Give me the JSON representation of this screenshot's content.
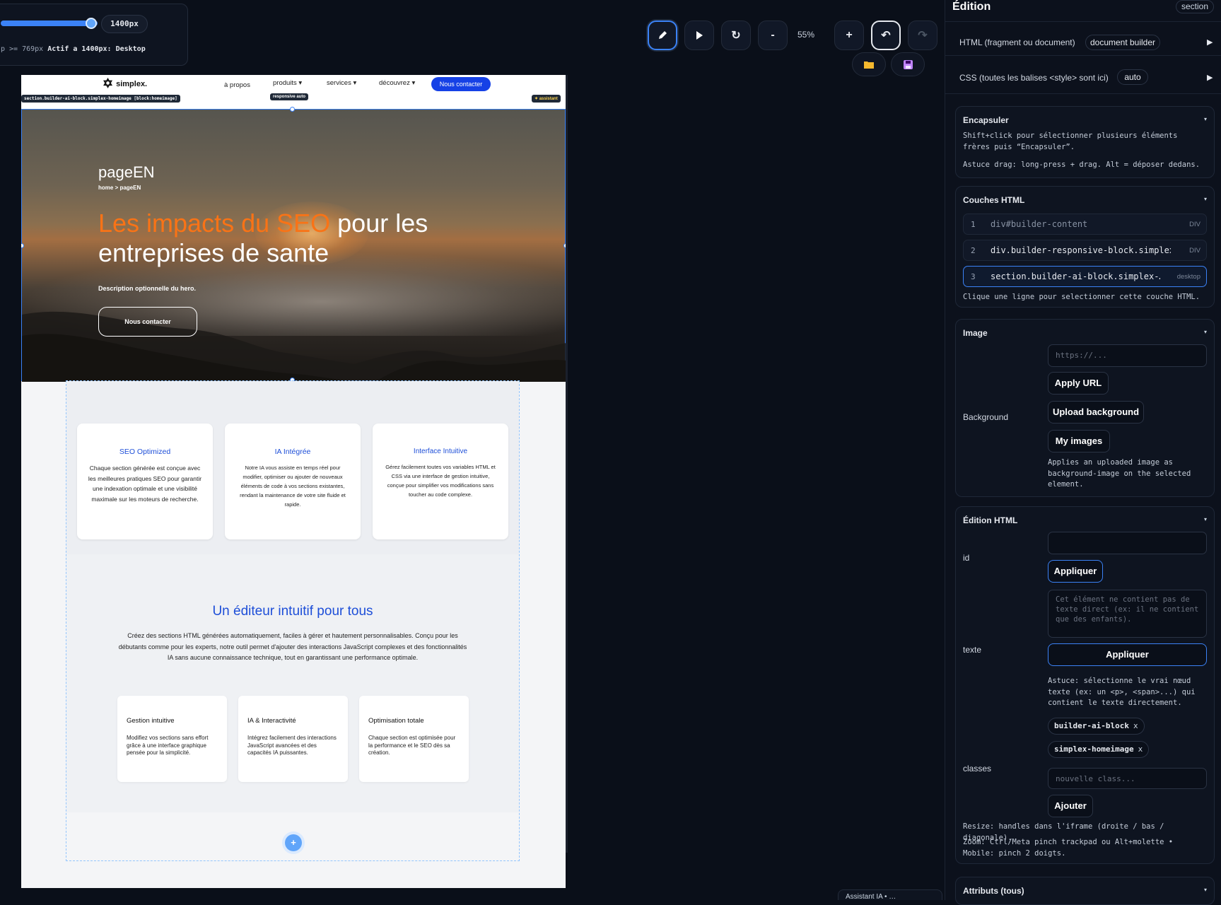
{
  "viewport_panel": {
    "width_value": "1400px",
    "breakpoint_prefix": "p >= 769px",
    "breakpoint_active": "Actif a 1400px: Desktop",
    "slider_fraction": 0.95
  },
  "toolbar": {
    "zoom": "55%",
    "minus": "-",
    "plus": "+"
  },
  "site": {
    "logo_text": "simplex.",
    "nav": [
      "à propos",
      "produits ▾",
      "services ▾",
      "découvrez ▾"
    ],
    "nav_cta": "Nous contacter",
    "tags": {
      "section": "section.builder-ai-block.simplex-homeimage [block:homeimage]",
      "responsive": "responsive auto",
      "assistant": "✦ assistant"
    },
    "hero": {
      "page_title": "pageEN",
      "breadcrumb": "home > pageEN",
      "headline_accent": "Les impacts du SEO",
      "headline_rest": " pour les entreprises de sante",
      "description": "Description optionnelle du hero.",
      "button": "Nous contacter"
    },
    "features": [
      {
        "title": "SEO Optimized",
        "text": "Chaque section générée est conçue avec les meilleures pratiques SEO pour garantir une indexation optimale et une visibilité maximale sur les moteurs de recherche."
      },
      {
        "title": "IA Intégrée",
        "text": "Notre IA vous assiste en temps réel pour modifier, optimiser ou ajouter de nouveaux éléments de code à vos sections existantes, rendant la maintenance de votre site fluide et rapide."
      },
      {
        "title": "Interface Intuitive",
        "text": "Gérez facilement toutes vos variables HTML et CSS via une interface de gestion intuitive, conçue pour simplifier vos modifications sans toucher au code complexe."
      }
    ],
    "editor": {
      "title": "Un éditeur intuitif pour tous",
      "lead": "Créez des sections HTML générées automatiquement, faciles à gérer et hautement personnalisables. Conçu pour les débutants comme pour les experts, notre outil permet d'ajouter des interactions JavaScript complexes et des fonctionnalités IA sans aucune connaissance technique, tout en garantissant une performance optimale.",
      "cards": [
        {
          "title": "Gestion intuitive",
          "text": "Modifiez vos sections sans effort grâce à une interface graphique pensée pour la simplicité."
        },
        {
          "title": "IA & Interactivité",
          "text": "Intégrez facilement des interactions JavaScript avancées et des capacités IA puissantes."
        },
        {
          "title": "Optimisation totale",
          "text": "Chaque section est optimisée pour la performance et le SEO dès sa création."
        }
      ],
      "add": "+"
    }
  },
  "panel": {
    "title": "Édition",
    "badge": "section",
    "html_row": {
      "label": "HTML (fragment ou document)",
      "chip": "document builder"
    },
    "css_row": {
      "label": "CSS (toutes les balises <style> sont ici)",
      "chip": "auto"
    },
    "encapsuler": {
      "title": "Encapsuler",
      "line1": "Shift+click pour sélectionner plusieurs éléments frères puis “Encapsuler”.",
      "line2": "Astuce drag: long-press + drag. Alt = déposer dedans."
    },
    "layers": {
      "title": "Couches HTML",
      "items": [
        {
          "n": "1",
          "name": "div#builder-content",
          "kind": "DIV"
        },
        {
          "n": "2",
          "name": "div.builder-responsive-block.simplex…",
          "kind": "DIV"
        },
        {
          "n": "3",
          "name": "section.builder-ai-block.simplex-…",
          "kind": "desktop"
        }
      ],
      "hint": "Clique une ligne pour selectionner cette couche HTML."
    },
    "image": {
      "title": "Image",
      "label": "Background",
      "url_placeholder": "https://...",
      "apply_url": "Apply URL",
      "upload": "Upload background",
      "my_images": "My images",
      "note": "Applies an uploaded image as background-image on the selected element."
    },
    "edit_html": {
      "title": "Édition HTML",
      "id_label": "id",
      "id_apply": "Appliquer",
      "text_label": "texte",
      "text_placeholder": "Cet élément ne contient pas de texte direct (ex: il ne contient que des enfants).",
      "text_apply": "Appliquer",
      "text_tip": "Astuce: sélectionne le vrai nœud texte (ex: un <p>, <span>...) qui contient le texte directement.",
      "classes_label": "classes",
      "classes": [
        "builder-ai-block",
        "simplex-homeimage"
      ],
      "class_placeholder": "nouvelle class...",
      "add": "Ajouter",
      "resize_note": "Resize: handles dans l'iframe (droite / bas / diagonale).",
      "zoom_note": "Zoom: Ctrl/Meta pinch trackpad ou Alt+molette • Mobile: pinch 2 doigts."
    },
    "attributes": {
      "title": "Attributs (tous)"
    }
  },
  "footer_button": "Assistant IA • …",
  "colors": {
    "accent_blue": "#3b82f6",
    "brand_blue": "#1641e6",
    "hero_accent": "#f97316",
    "panel_bg": "#0c111c"
  }
}
